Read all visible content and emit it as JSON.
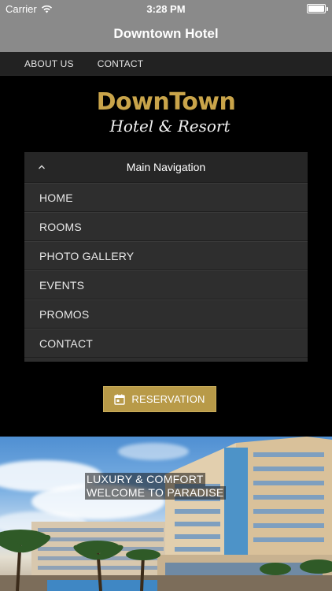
{
  "status": {
    "carrier": "Carrier",
    "time": "3:28 PM",
    "battery_level": 1.0
  },
  "header": {
    "title": "Downtown Hotel"
  },
  "topmenu": {
    "items": [
      {
        "label": "ABOUT US"
      },
      {
        "label": "CONTACT"
      }
    ]
  },
  "logo": {
    "line1": "DownTown",
    "line2": "Hotel & Resort"
  },
  "main_nav": {
    "title": "Main Navigation",
    "items": [
      {
        "label": "HOME"
      },
      {
        "label": "ROOMS"
      },
      {
        "label": "PHOTO GALLERY"
      },
      {
        "label": "EVENTS"
      },
      {
        "label": "PROMOS"
      },
      {
        "label": "CONTACT"
      }
    ]
  },
  "reservation": {
    "label": "RESERVATION",
    "icon": "calendar-icon"
  },
  "hero": {
    "caption_line1": "LUXURY & COMFORT",
    "caption_line2": "WELCOME TO PARADISE"
  },
  "colors": {
    "header_gray": "#8a8a8a",
    "gold": "#b89a48",
    "panel": "#2e2e2e"
  }
}
